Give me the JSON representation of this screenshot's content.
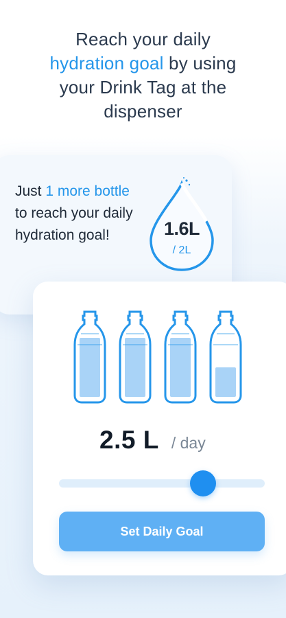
{
  "headline": {
    "line1": "Reach your daily",
    "line2_accent": "hydration goal",
    "line2_rest": " by using",
    "line3": "your Drink Tag at the",
    "line4": "dispenser"
  },
  "progress": {
    "prefix": "Just ",
    "accent": "1 more bottle",
    "suffix": " to reach your daily hydration goal!",
    "current": "1.6L",
    "goal": "/ 2L",
    "fill_fraction": 0.8
  },
  "goal_setter": {
    "bottle_fills": [
      1.0,
      1.0,
      1.0,
      0.5
    ],
    "amount_value": "2.5 L",
    "amount_unit": "/ day",
    "slider_fraction": 0.7,
    "button_label": "Set Daily Goal"
  },
  "colors": {
    "accent": "#2596ea",
    "water": "#a9d3f7",
    "button": "#5fb0f4",
    "thumb": "#1f8ff0"
  }
}
